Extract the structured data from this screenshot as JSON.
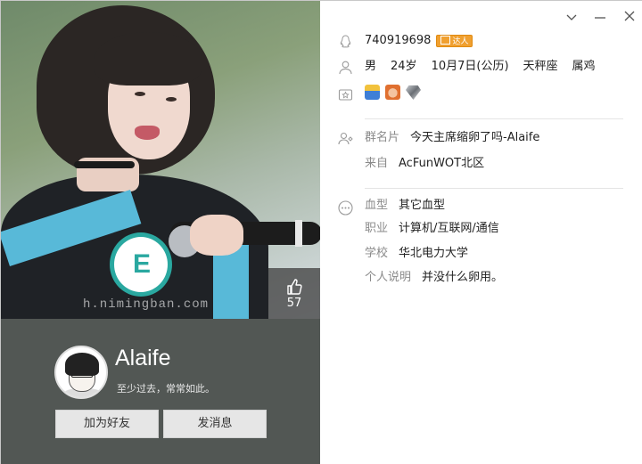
{
  "photo": {
    "watermark": "h.nimingban.com",
    "badge_letter": "E"
  },
  "likes": {
    "count": "57"
  },
  "profile": {
    "nickname": "Alaife",
    "signature": "至少过去，常常如此。",
    "add_friend_label": "加为好友",
    "send_message_label": "发消息"
  },
  "info": {
    "qq_number": "740919698",
    "vip_badge": "达人",
    "gender": "男",
    "age": "24岁",
    "birthday": "10月7日(公历)",
    "constellation": "天秤座",
    "zodiac": "属鸡",
    "badges": [
      "figure-badge-icon",
      "girl-badge-icon",
      "diamond-badge-icon"
    ],
    "group_card_label": "群名片",
    "group_card_value": "今天主席缩卵了吗-Alaife",
    "from_label": "来自",
    "from_value": "AcFunWOT北区",
    "blood_label": "血型",
    "blood_value": "其它血型",
    "job_label": "职业",
    "job_value": "计算机/互联网/通信",
    "school_label": "学校",
    "school_value": "华北电力大学",
    "bio_label": "个人说明",
    "bio_value": "并没什么卵用。"
  },
  "colors": {
    "left_bg": "#525754",
    "vip": "#f0a030",
    "label": "#8a8a8a"
  }
}
